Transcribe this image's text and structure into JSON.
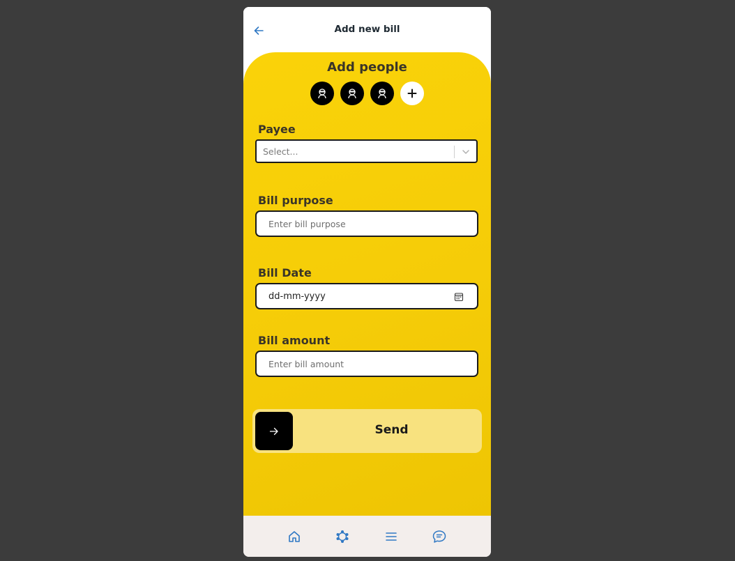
{
  "header": {
    "title": "Add new bill",
    "back_icon": "arrow-left-icon"
  },
  "people": {
    "title": "Add people",
    "avatars": [
      {
        "icon": "person-avatar-icon"
      },
      {
        "icon": "person-avatar-icon"
      },
      {
        "icon": "person-avatar-icon"
      }
    ],
    "add_icon": "plus-icon"
  },
  "form": {
    "payee": {
      "label": "Payee",
      "placeholder": "Select...",
      "value": ""
    },
    "purpose": {
      "label": "Bill purpose",
      "placeholder": "Enter bill purpose",
      "value": ""
    },
    "date": {
      "label": "Bill Date",
      "value": "dd-mm-yyyy"
    },
    "amount": {
      "label": "Bill amount",
      "placeholder": "Enter bill amount",
      "value": ""
    }
  },
  "send": {
    "label": "Send",
    "icon": "arrow-right-icon"
  },
  "bottom_nav": {
    "items": [
      {
        "icon": "home-icon"
      },
      {
        "icon": "network-icon"
      },
      {
        "icon": "menu-icon"
      },
      {
        "icon": "chat-icon"
      }
    ]
  },
  "colors": {
    "background": "#3c3c3c",
    "accent_yellow": "#f5cc08",
    "send_track": "#f8e27f",
    "nav_icon": "#2f78c4",
    "nav_bg": "#f3eeec"
  }
}
